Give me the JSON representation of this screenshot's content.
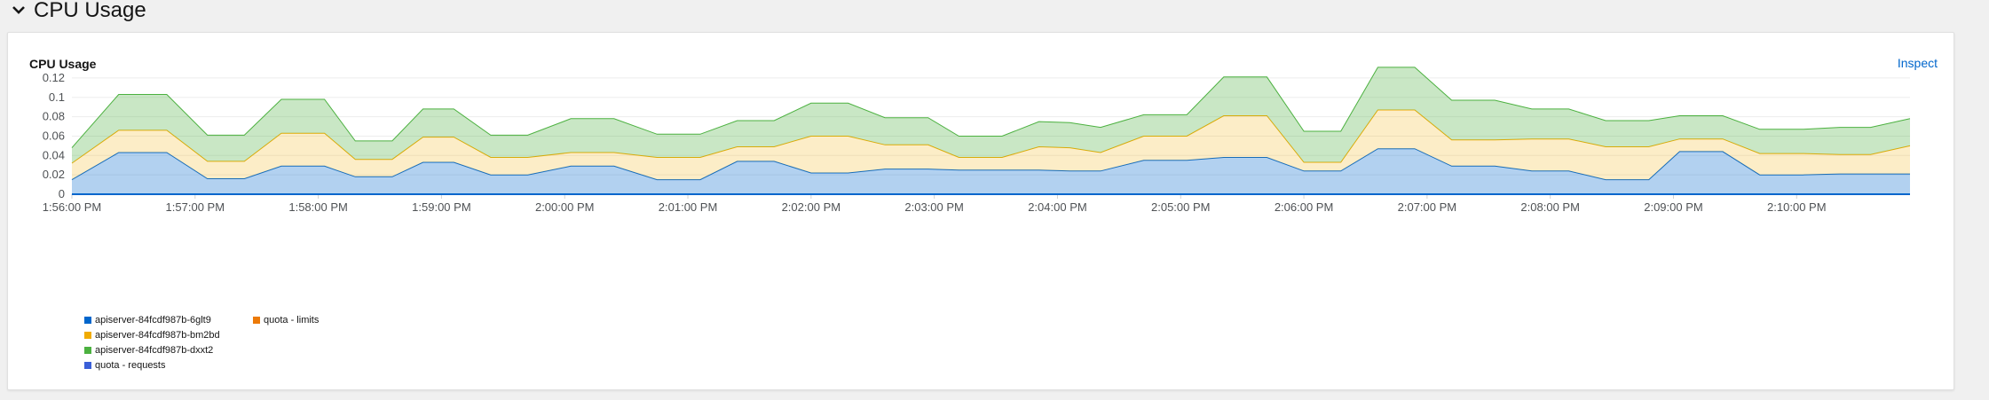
{
  "section": {
    "title": "CPU Usage"
  },
  "card": {
    "title": "CPU Usage",
    "inspect_label": "Inspect"
  },
  "colors": {
    "blue": "#0066cc",
    "gold": "#f0ab00",
    "green": "#4cb140",
    "orange": "#ec7a08",
    "indigo": "#3a5fd8"
  },
  "chart_data": {
    "type": "area",
    "stacked": true,
    "y_ticks": [
      "0",
      "0.02",
      "0.04",
      "0.06",
      "0.08",
      "0.1",
      "0.12"
    ],
    "ylim": [
      0,
      0.13
    ],
    "x_ticks": [
      "1:56:00 PM",
      "1:57:00 PM",
      "1:58:00 PM",
      "1:59:00 PM",
      "2:00:00 PM",
      "2:01:00 PM",
      "2:02:00 PM",
      "2:03:00 PM",
      "2:04:00 PM",
      "2:05:00 PM",
      "2:06:00 PM",
      "2:07:00 PM",
      "2:08:00 PM",
      "2:09:00 PM",
      "2:10:00 PM"
    ],
    "x_start": "1:56:00 PM",
    "x_end": "2:10:55 PM",
    "x_minutes": [
      0,
      0.38,
      0.77,
      1.1,
      1.4,
      1.7,
      2.05,
      2.3,
      2.6,
      2.85,
      3.1,
      3.4,
      3.7,
      4.05,
      4.4,
      4.75,
      5.1,
      5.4,
      5.7,
      6.0,
      6.3,
      6.6,
      6.95,
      7.2,
      7.55,
      7.85,
      8.1,
      8.35,
      8.7,
      9.05,
      9.35,
      9.7,
      10.0,
      10.3,
      10.6,
      10.9,
      11.2,
      11.55,
      11.85,
      12.15,
      12.45,
      12.8,
      13.05,
      13.4,
      13.7,
      14.05,
      14.35,
      14.6,
      14.92
    ],
    "series": [
      {
        "name": "apiserver-84fcdf987b-6glt9",
        "color": "#0066cc",
        "values": [
          0.015,
          0.043,
          0.043,
          0.016,
          0.016,
          0.029,
          0.029,
          0.018,
          0.018,
          0.033,
          0.033,
          0.02,
          0.02,
          0.029,
          0.029,
          0.015,
          0.015,
          0.034,
          0.034,
          0.022,
          0.022,
          0.026,
          0.026,
          0.025,
          0.025,
          0.025,
          0.024,
          0.024,
          0.035,
          0.035,
          0.038,
          0.038,
          0.024,
          0.024,
          0.047,
          0.047,
          0.029,
          0.029,
          0.024,
          0.024,
          0.015,
          0.015,
          0.044,
          0.044,
          0.02,
          0.02,
          0.021,
          0.021,
          0.021
        ]
      },
      {
        "name": "apiserver-84fcdf987b-bm2bd",
        "color": "#f0ab00",
        "values": [
          0.017,
          0.023,
          0.023,
          0.018,
          0.018,
          0.034,
          0.034,
          0.018,
          0.018,
          0.026,
          0.026,
          0.018,
          0.018,
          0.014,
          0.014,
          0.023,
          0.023,
          0.015,
          0.015,
          0.038,
          0.038,
          0.025,
          0.025,
          0.013,
          0.013,
          0.024,
          0.024,
          0.019,
          0.025,
          0.025,
          0.043,
          0.043,
          0.009,
          0.009,
          0.04,
          0.04,
          0.027,
          0.027,
          0.033,
          0.033,
          0.034,
          0.034,
          0.013,
          0.013,
          0.022,
          0.022,
          0.02,
          0.02,
          0.029
        ]
      },
      {
        "name": "apiserver-84fcdf987b-dxxt2",
        "color": "#4cb140",
        "values": [
          0.016,
          0.037,
          0.037,
          0.027,
          0.027,
          0.035,
          0.035,
          0.019,
          0.019,
          0.029,
          0.029,
          0.023,
          0.023,
          0.035,
          0.035,
          0.024,
          0.024,
          0.027,
          0.027,
          0.034,
          0.034,
          0.028,
          0.028,
          0.022,
          0.022,
          0.026,
          0.026,
          0.026,
          0.022,
          0.022,
          0.04,
          0.04,
          0.032,
          0.032,
          0.044,
          0.044,
          0.041,
          0.041,
          0.031,
          0.031,
          0.027,
          0.027,
          0.024,
          0.024,
          0.025,
          0.025,
          0.028,
          0.028,
          0.028
        ]
      }
    ],
    "legend": [
      {
        "name": "apiserver-84fcdf987b-6glt9",
        "color": "#0066cc"
      },
      {
        "name": "quota - limits",
        "color": "#ec7a08"
      },
      {
        "name": "apiserver-84fcdf987b-bm2bd",
        "color": "#f0ab00"
      },
      {
        "name": "",
        "color": ""
      },
      {
        "name": "apiserver-84fcdf987b-dxxt2",
        "color": "#4cb140"
      },
      {
        "name": "",
        "color": ""
      },
      {
        "name": "quota - requests",
        "color": "#3a5fd8"
      }
    ]
  }
}
